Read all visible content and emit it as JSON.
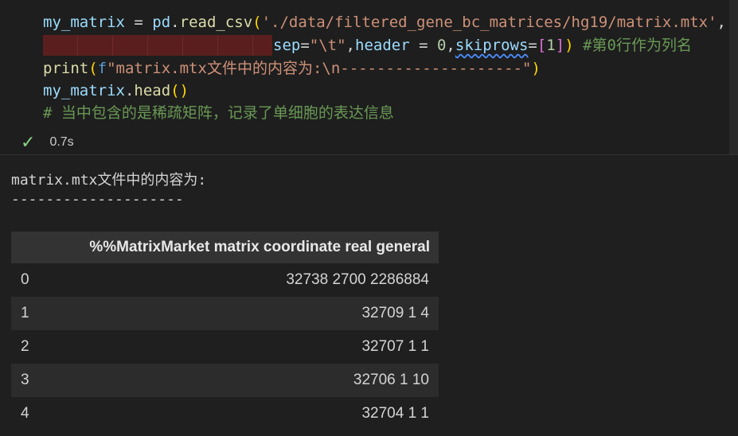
{
  "code": {
    "line1": {
      "var": "my_matrix",
      "eq": " = ",
      "mod": "pd",
      "dot": ".",
      "fn": "read_csv",
      "open": "(",
      "path": "'./data/filtered_gene_bc_matrices/hg19/matrix.mtx'",
      "comma": ","
    },
    "line2": {
      "sep_kw": "sep",
      "sep_eq": "=",
      "sep_val": "\"\\t\"",
      "c1": ",",
      "header_kw": "header",
      "header_eq": " = ",
      "header_val": "0",
      "c2": ",",
      "skip_kw": "skiprows",
      "skip_eq": "=",
      "skip_open": "[",
      "skip_val": "1",
      "skip_close": "]",
      "close": ")",
      "comment": " #第0行作为列名"
    },
    "line3": {
      "fn": "print",
      "open": "(",
      "prefix": "f",
      "str": "\"matrix.mtx文件中的内容为:\\n--------------------\"",
      "close": ")"
    },
    "line4": {
      "var": "my_matrix",
      "dot": ".",
      "fn": "head",
      "parens": "()"
    },
    "line5": {
      "comment": "# 当中包含的是稀疏矩阵，记录了单细胞的表达信息"
    }
  },
  "execution": {
    "status_icon": "check-icon",
    "time": "0.7s",
    "status_color": "#89d185"
  },
  "output": {
    "line1": "matrix.mtx文件中的内容为:",
    "line2": "--------------------",
    "table": {
      "header": "%%MatrixMarket matrix coordinate real general",
      "rows": [
        {
          "index": "0",
          "value": "32738 2700 2286884"
        },
        {
          "index": "1",
          "value": "32709 1 4"
        },
        {
          "index": "2",
          "value": "32707 1 1"
        },
        {
          "index": "3",
          "value": "32706 1 10"
        },
        {
          "index": "4",
          "value": "32704 1 1"
        }
      ]
    }
  }
}
